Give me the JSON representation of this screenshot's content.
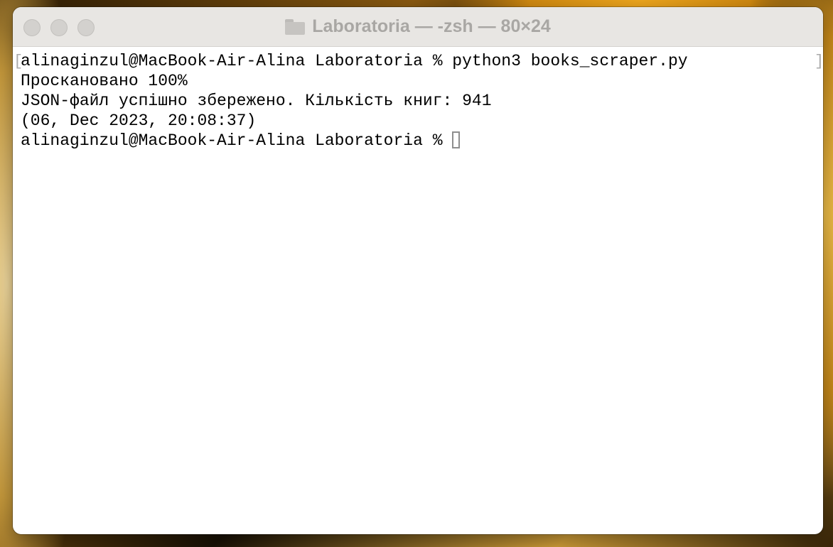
{
  "window": {
    "title": "Laboratoria — -zsh — 80×24",
    "title_icon": "folder-icon"
  },
  "terminal": {
    "lines": [
      "alinaginzul@MacBook-Air-Alina Laboratoria % python3 books_scraper.py",
      "Проскановано 100%",
      "JSON-файл успішно збережено. Кількість книг: 941",
      "(06, Dec 2023, 20:08:37)"
    ],
    "prompt": "alinaginzul@MacBook-Air-Alina Laboratoria % "
  }
}
